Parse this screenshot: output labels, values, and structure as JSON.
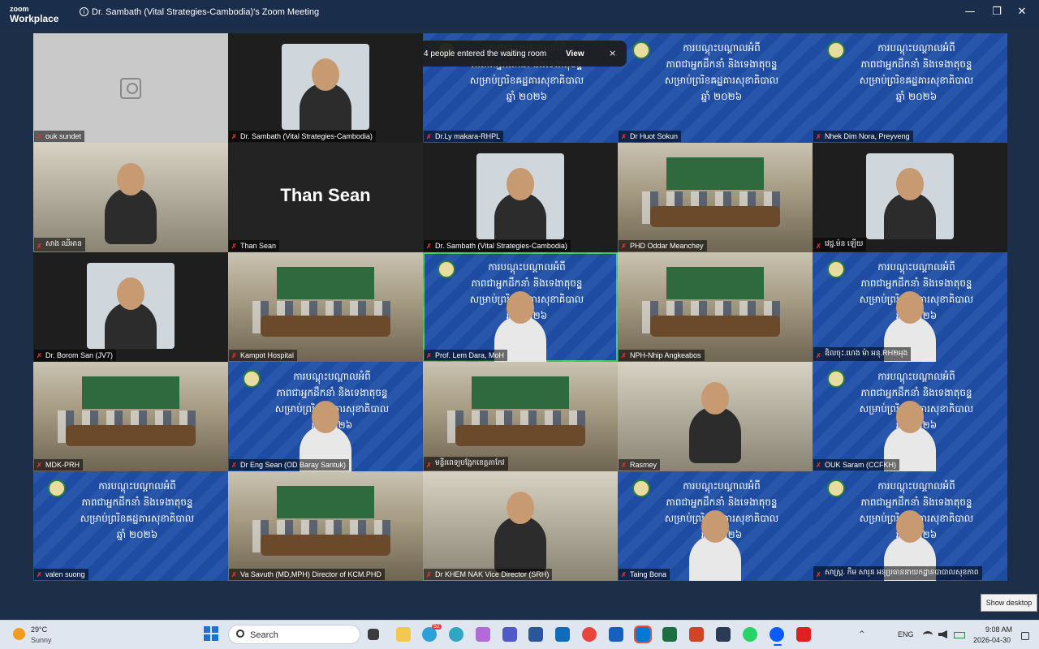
{
  "app": {
    "brand_line1": "zoom",
    "brand_line2": "Workplace",
    "meeting_title": "Dr. Sambath (Vital Strategies-Cambodia)'s Zoom Meeting"
  },
  "window_controls": {
    "minimize": "—",
    "restore": "❐",
    "close": "✕"
  },
  "notification": {
    "message": "4 people entered the waiting room",
    "view_label": "View",
    "close_label": "×"
  },
  "participants": [
    {
      "name": "ouk sundet",
      "kind": "camera-off"
    },
    {
      "name": "Dr. Sambath (Vital Strategies-Cambodia)",
      "kind": "person-thumb"
    },
    {
      "name": "Dr.Ly makara-RHPL",
      "kind": "banner"
    },
    {
      "name": "Dr Huot Sokun",
      "kind": "banner"
    },
    {
      "name": "Nhek Dim Nora, Preyveng",
      "kind": "banner"
    },
    {
      "name": "សាង ឈីអាន",
      "kind": "person"
    },
    {
      "name": "Than Sean",
      "kind": "name-only",
      "display_name": "Than Sean"
    },
    {
      "name": "Dr. Sambath (Vital Strategies-Cambodia)",
      "kind": "person-thumb"
    },
    {
      "name": "PHD Oddar Meanchey",
      "kind": "room"
    },
    {
      "name": "វេជ្ជ.ម៉ន ឡើយ",
      "kind": "person-thumb"
    },
    {
      "name": "Dr. Borom San (JV7)",
      "kind": "person-thumb"
    },
    {
      "name": "Kampot Hospital",
      "kind": "room"
    },
    {
      "name": "Prof. Lem Dara, MoH",
      "kind": "banner-person",
      "active": true
    },
    {
      "name": "NPH-Nhip Angkeabos",
      "kind": "room"
    },
    {
      "name": "ឌិលចុះ.ហេង ម៉ា អនុ.RH២អុង",
      "kind": "banner-person"
    },
    {
      "name": "MDK-PRH",
      "kind": "room"
    },
    {
      "name": "Dr Eng Sean (OD Baray Santuk)",
      "kind": "banner-person"
    },
    {
      "name": "មន្ទីរពេទ្យបង្អែកខេត្តតាកែវ",
      "kind": "room"
    },
    {
      "name": "Rasmey",
      "kind": "person"
    },
    {
      "name": "OUK Saram (CCFKH)",
      "kind": "banner-person"
    },
    {
      "name": "valen suong",
      "kind": "banner"
    },
    {
      "name": "Va Savuth (MD,MPH) Director of KCM.PHD",
      "kind": "room"
    },
    {
      "name": "Dr KHEM NAK Vice Director (SRH)",
      "kind": "person"
    },
    {
      "name": "Taing Bona",
      "kind": "banner-person"
    },
    {
      "name": "សាស្ត្រ. កឹម សារុន អនុប្រធាននាយកដ្ឋានបាបាលសុខភាព",
      "kind": "banner-person"
    }
  ],
  "banner_text": {
    "line1": "ការបណ្ដុះបណ្ដាលអំពី",
    "line2": "ភាពជាអ្នកដឹកនាំ និងទេងាតុចន្ទ្ត",
    "line3": "សម្រាប់ព្ររិខឝដ្ឋគារសុខាគិបាល",
    "line4": "ឆ្នាំ ២០២៦"
  },
  "show_desktop": "Show desktop",
  "taskbar": {
    "weather_temp": "29°C",
    "weather_desc": "Sunny",
    "search_placeholder": "Search",
    "language": "ENG",
    "time": "9:08 AM",
    "date": "2026-04-30",
    "telegram_badge": "52"
  },
  "colors": {
    "accent": "#3fce62",
    "banner_blue": "#1f4fa8",
    "titlebar": "#1a2d4a"
  }
}
